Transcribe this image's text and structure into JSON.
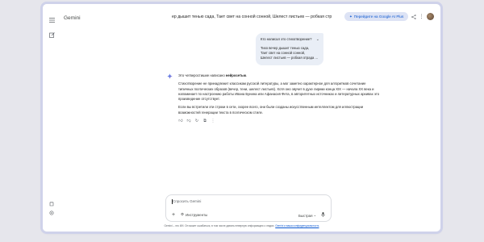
{
  "app": {
    "name": "Gemini"
  },
  "header": {
    "conversation_title": "ер дышит тенью сада, Тает свет на сонной сонной, Шелест листьев — робкая стр",
    "upgrade_label": "Перейдите на Google AI Plus"
  },
  "user_message": {
    "question": "Кто написал это стихотворение?",
    "lines": [
      "Тихо вечер дышит тенью сада,",
      "Тает свет на сонной сонной,",
      "Шелест листьев — робкая отрада ..."
    ]
  },
  "response": {
    "intro_prefix": "Это четверостишие написано ",
    "intro_bold": "нейросетью",
    "intro_suffix": ".",
    "p2": "Стихотворение не принадлежит классикам русской литературы, а мог заметно характерное для алгоритмов сочетание типичных поэтических образов (вечер, тени, шелест листьев). Хотя оно звучит в духе лирики конца XIX — начала XX века и напоминает по настроению работы Ивана Бунина или Афанасия Фета, в авторитетных источниках и литературных архивах это произведение отсутствует.",
    "p3": "Если вы встретили эти строки в сети, скорее всего, они были созданы искусственным интеллектом для иллюстрации возможностей генерации текста в поэтическом стиле."
  },
  "composer": {
    "placeholder": "Спросить Gemini",
    "tools_label": "Инструменты",
    "mode_label": "Быстрая"
  },
  "footer": {
    "disclaimer": "Gemini – это ИИ. Он может ошибаться, в том числе давать неверную информацию о людях.",
    "link": "Gemini и ваша конфиденциальность"
  },
  "colors": {
    "accent": "#0b57d0",
    "upgrade_bg": "#dde3f5",
    "user_bubble": "#e9eef6",
    "window_frame": "#cfd2ea"
  }
}
